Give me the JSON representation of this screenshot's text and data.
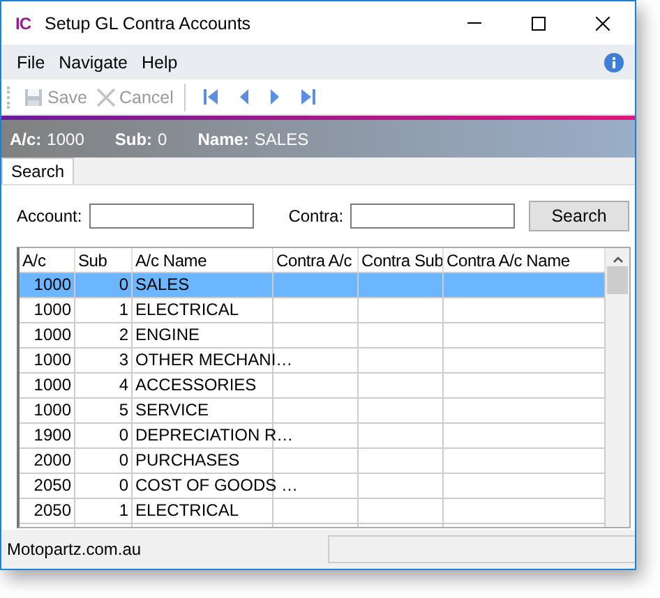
{
  "window": {
    "app_icon": "IC",
    "title": "Setup GL Contra Accounts"
  },
  "menu": [
    "File",
    "Navigate",
    "Help"
  ],
  "toolbar": [
    {
      "kind": "save",
      "label": "Save",
      "disabled": true
    },
    {
      "kind": "cancel",
      "label": "Cancel",
      "disabled": true
    },
    {
      "kind": "first",
      "disabled": false
    },
    {
      "kind": "prev",
      "disabled": false
    },
    {
      "kind": "next",
      "disabled": false
    },
    {
      "kind": "last",
      "disabled": false
    }
  ],
  "info": [
    {
      "label": "A/c:",
      "value": "1000"
    },
    {
      "label": "Sub:",
      "value": "0"
    },
    {
      "label": "Name:",
      "value": "SALES"
    }
  ],
  "tabs": [
    {
      "label": "Search",
      "selected": true
    }
  ],
  "search": {
    "account_label": "Account:",
    "contra_label": "Contra:",
    "button": "Search"
  },
  "table": {
    "columns": [
      "A/c",
      "Sub",
      "A/c Name",
      "Contra A/c",
      "Contra Sub",
      "Contra A/c Name"
    ],
    "rows": [
      {
        "cells": [
          "1000",
          "0",
          "SALES",
          "",
          "",
          ""
        ],
        "selected": true
      },
      {
        "cells": [
          "1000",
          "1",
          "ELECTRICAL",
          "",
          "",
          ""
        ],
        "selected": false
      },
      {
        "cells": [
          "1000",
          "2",
          "ENGINE",
          "",
          "",
          ""
        ],
        "selected": false
      },
      {
        "cells": [
          "1000",
          "3",
          "OTHER MECHANI…",
          "",
          "",
          ""
        ],
        "selected": false
      },
      {
        "cells": [
          "1000",
          "4",
          "ACCESSORIES",
          "",
          "",
          ""
        ],
        "selected": false
      },
      {
        "cells": [
          "1000",
          "5",
          "SERVICE",
          "",
          "",
          ""
        ],
        "selected": false
      },
      {
        "cells": [
          "1900",
          "0",
          "DEPRECIATION R…",
          "",
          "",
          ""
        ],
        "selected": false
      },
      {
        "cells": [
          "2000",
          "0",
          "PURCHASES",
          "",
          "",
          ""
        ],
        "selected": false
      },
      {
        "cells": [
          "2050",
          "0",
          "COST OF GOODS …",
          "",
          "",
          ""
        ],
        "selected": false
      },
      {
        "cells": [
          "2050",
          "1",
          "ELECTRICAL",
          "",
          "",
          ""
        ],
        "selected": false
      }
    ]
  },
  "status_bar": [
    "Motopartz.com.au"
  ]
}
